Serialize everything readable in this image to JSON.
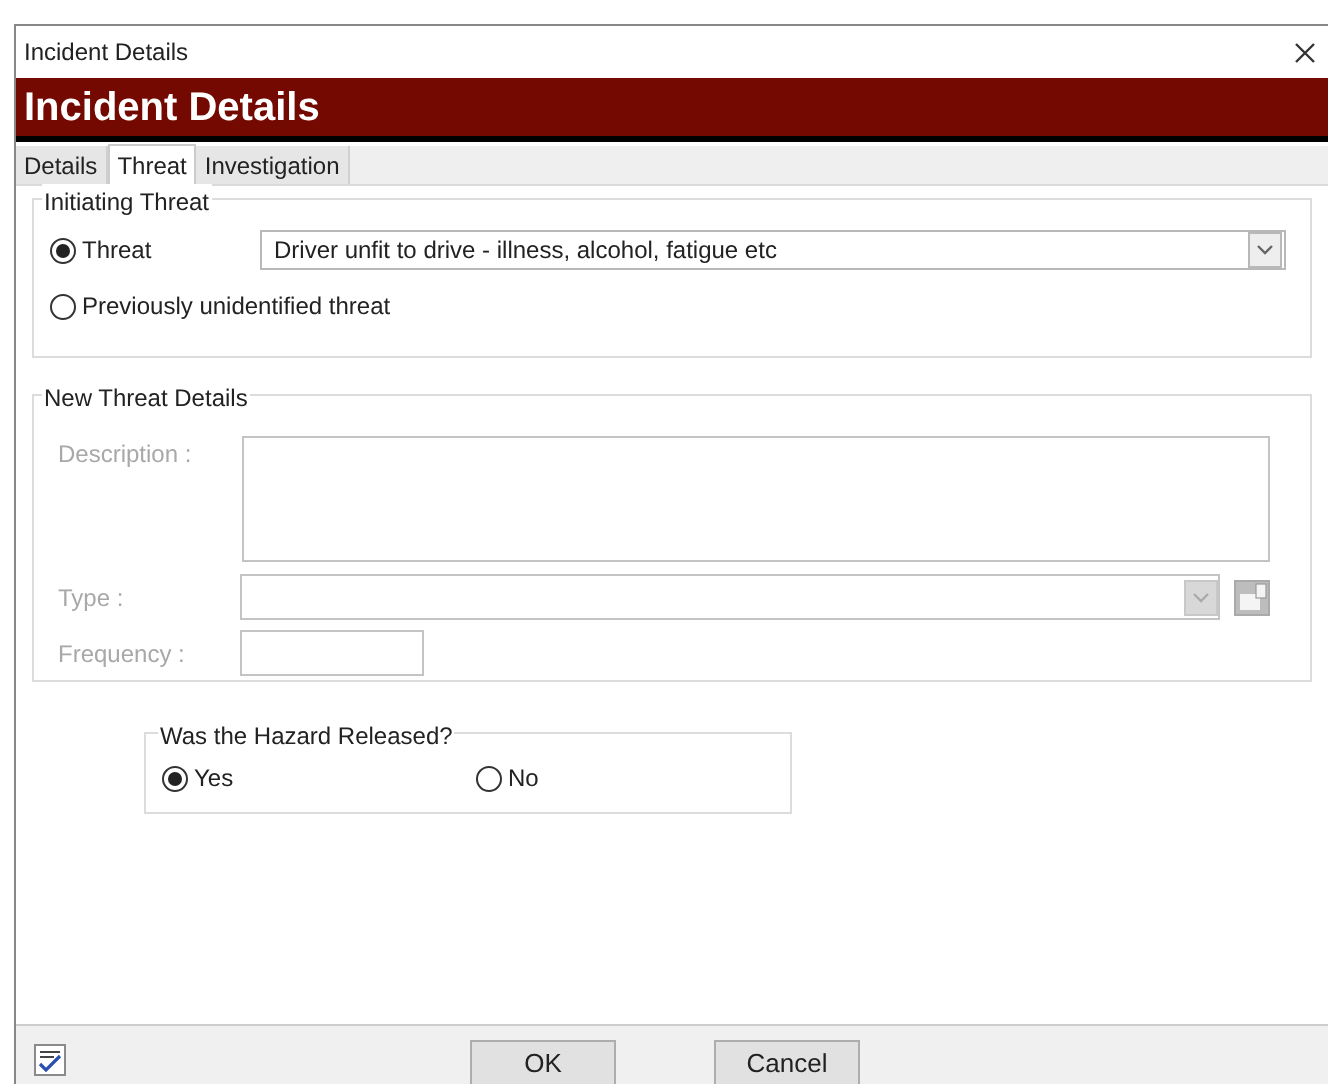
{
  "window": {
    "title": "Incident Details"
  },
  "header": {
    "title": "Incident Details"
  },
  "tabs": [
    {
      "label": "Details",
      "selected": false
    },
    {
      "label": "Threat",
      "selected": true
    },
    {
      "label": "Investigation",
      "selected": false
    }
  ],
  "initiating_threat": {
    "legend": "Initiating Threat",
    "options": [
      {
        "label": "Threat",
        "selected": true,
        "value": "Driver unfit to drive - illness, alcohol, fatigue etc"
      },
      {
        "label": "Previously unidentified threat",
        "selected": false
      }
    ]
  },
  "new_threat_details": {
    "legend": "New Threat Details",
    "disabled": true,
    "description_label": "Description :",
    "type_label": "Type :",
    "frequency_label": "Frequency :"
  },
  "hazard_released": {
    "legend": "Was the Hazard Released?",
    "options": [
      {
        "label": "Yes",
        "selected": true
      },
      {
        "label": "No",
        "selected": false
      }
    ]
  },
  "buttons": [
    "OK",
    "Cancel"
  ]
}
